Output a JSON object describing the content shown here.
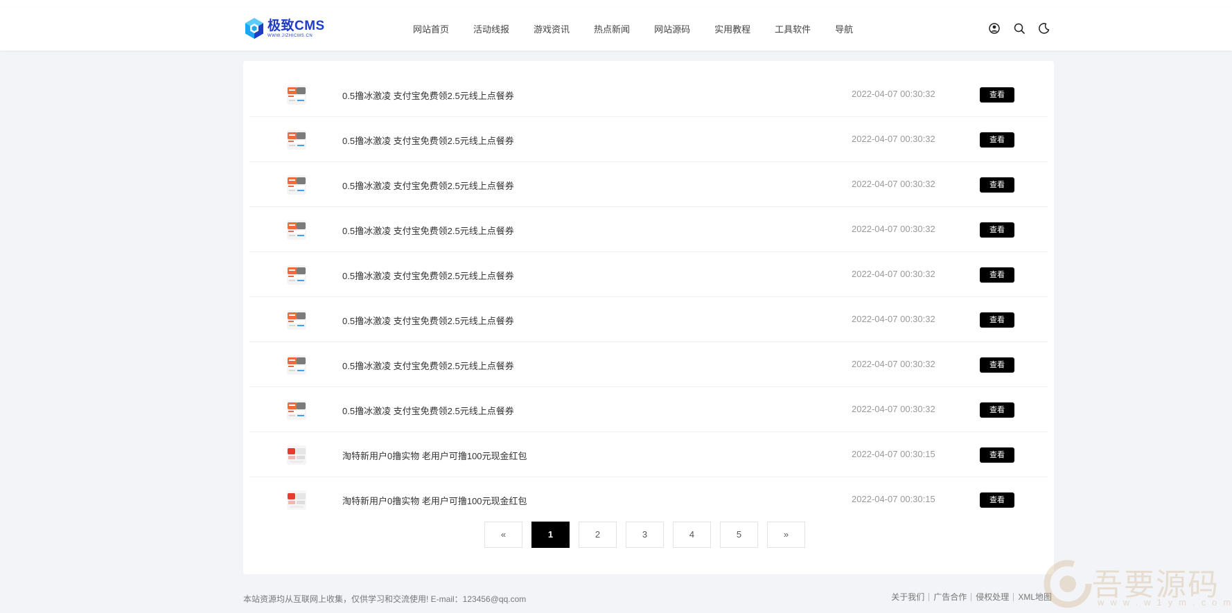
{
  "header": {
    "logo_title": "极致CMS",
    "logo_sub": "WWW.JIZHICMS.CN",
    "nav": [
      "网站首页",
      "活动线报",
      "游戏资讯",
      "热点新闻",
      "网站源码",
      "实用教程",
      "工具软件",
      "导航"
    ],
    "icons": [
      "user-circle-icon",
      "search-icon",
      "moon-icon"
    ]
  },
  "list": {
    "view_label": "查看",
    "rows": [
      {
        "title": "0.5撸冰激凌 支付宝免费领2.5元线上点餐券",
        "time": "2022-04-07 00:30:32",
        "thumb": "coupon"
      },
      {
        "title": "0.5撸冰激凌 支付宝免费领2.5元线上点餐券",
        "time": "2022-04-07 00:30:32",
        "thumb": "coupon"
      },
      {
        "title": "0.5撸冰激凌 支付宝免费领2.5元线上点餐券",
        "time": "2022-04-07 00:30:32",
        "thumb": "coupon"
      },
      {
        "title": "0.5撸冰激凌 支付宝免费领2.5元线上点餐券",
        "time": "2022-04-07 00:30:32",
        "thumb": "coupon"
      },
      {
        "title": "0.5撸冰激凌 支付宝免费领2.5元线上点餐券",
        "time": "2022-04-07 00:30:32",
        "thumb": "coupon"
      },
      {
        "title": "0.5撸冰激凌 支付宝免费领2.5元线上点餐券",
        "time": "2022-04-07 00:30:32",
        "thumb": "coupon"
      },
      {
        "title": "0.5撸冰激凌 支付宝免费领2.5元线上点餐券",
        "time": "2022-04-07 00:30:32",
        "thumb": "coupon"
      },
      {
        "title": "0.5撸冰激凌 支付宝免费领2.5元线上点餐券",
        "time": "2022-04-07 00:30:32",
        "thumb": "coupon"
      },
      {
        "title": "淘特新用户0撸实物 老用户可撸100元现金红包",
        "time": "2022-04-07 00:30:15",
        "thumb": "redpacket"
      },
      {
        "title": "淘特新用户0撸实物 老用户可撸100元现金红包",
        "time": "2022-04-07 00:30:15",
        "thumb": "redpacket"
      }
    ]
  },
  "pagination": {
    "prev": "«",
    "pages": [
      "1",
      "2",
      "3",
      "4",
      "5"
    ],
    "next": "»",
    "current": "1"
  },
  "footer": {
    "text": "本站资源均从互联网上收集，仅供学习和交流使用! E-mail：123456@qq.com",
    "links": [
      "关于我们",
      "广告合作",
      "侵权处理",
      "XML地图"
    ]
  },
  "watermark": {
    "text": "吾要源码",
    "url": "www.w1ym.com"
  },
  "colors": {
    "accent": "#000000",
    "logo": "#1f3cc7",
    "background": "#f3f4f8",
    "muted": "#999999"
  }
}
